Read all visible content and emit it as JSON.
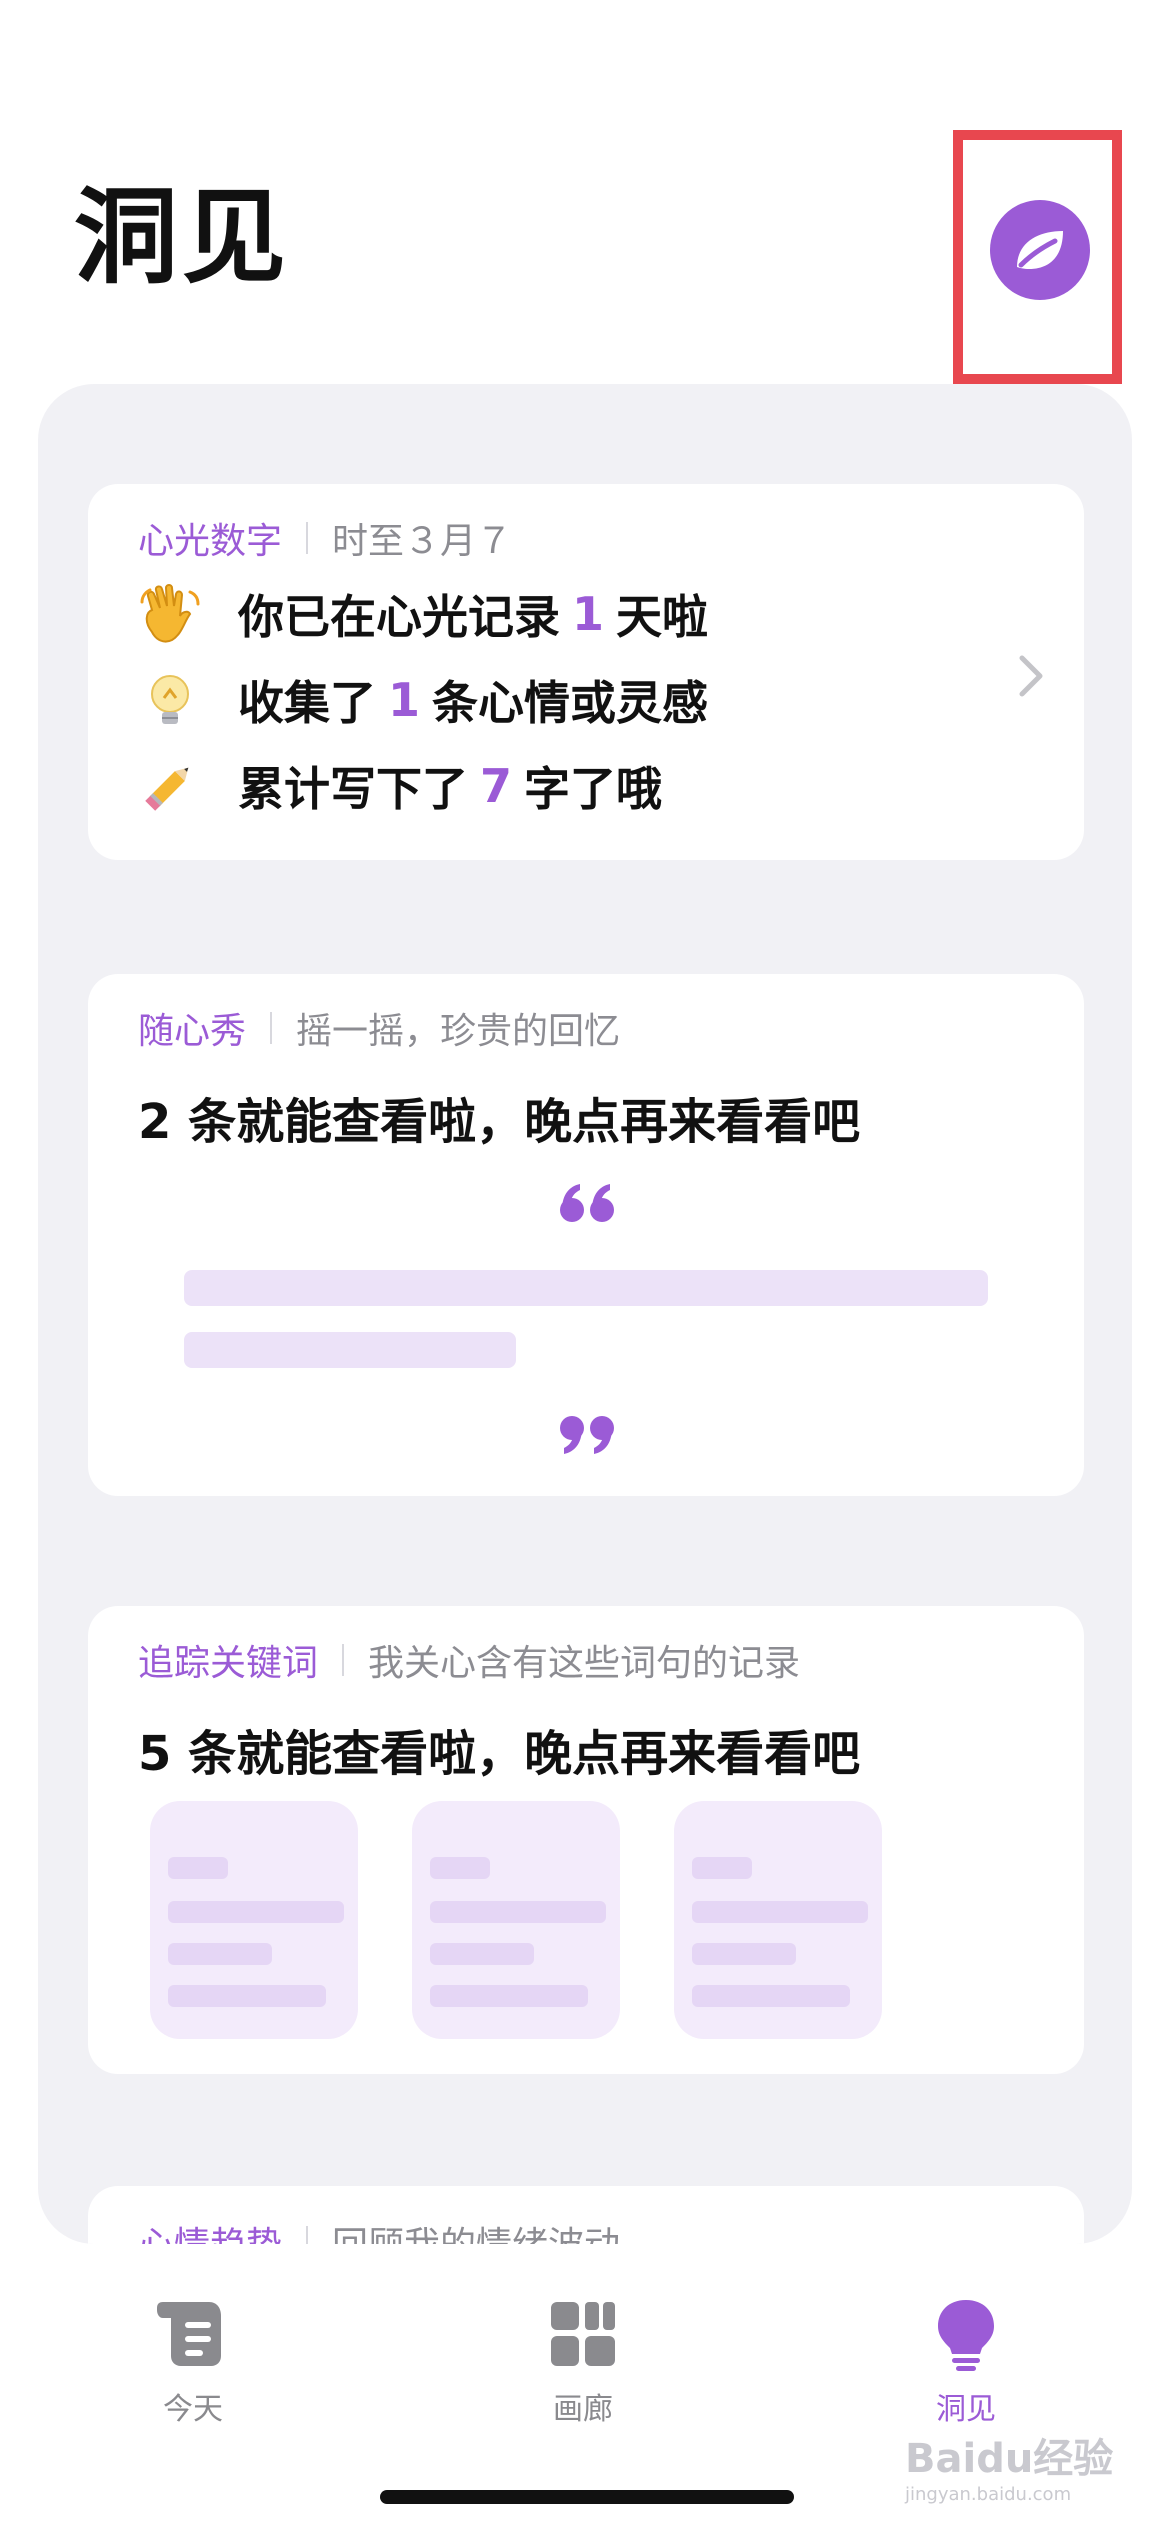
{
  "header": {
    "title": "洞见"
  },
  "stats_card": {
    "title": "心光数字",
    "subtitle": "时至３月７",
    "rows": [
      {
        "icon": "waving-hand-icon",
        "pre": "你已在心光记录",
        "num": "1",
        "post": "天啦"
      },
      {
        "icon": "light-bulb-icon",
        "pre": "收集了",
        "num": "1",
        "post": "条心情或灵感"
      },
      {
        "icon": "pencil-icon",
        "pre": "累计写下了",
        "num": "7",
        "post": "字了哦"
      }
    ]
  },
  "random_card": {
    "title": "随心秀",
    "subtitle": "摇一摇，珍贵的回忆",
    "message": "2 条就能查看啦，晚点再来看看吧"
  },
  "keywords_card": {
    "title": "追踪关键词",
    "subtitle": "我关心含有这些词句的记录",
    "message": "5 条就能查看啦，晚点再来看看吧"
  },
  "mood_card": {
    "title": "心情趋势",
    "subtitle": "回顾我的情绪波动"
  },
  "tabbar": {
    "tabs": [
      {
        "label": "今天",
        "icon": "scroll-icon",
        "active": false
      },
      {
        "label": "画廊",
        "icon": "grid-icon",
        "active": false
      },
      {
        "label": "洞见",
        "icon": "light-bulb-icon",
        "active": true
      }
    ]
  },
  "watermark": {
    "text": "Baidu经验",
    "sub": "jingyan.baidu.com"
  },
  "colors": {
    "accent": "#9b5bd6",
    "highlight": "#e8474f",
    "panel": "#f1f1f5"
  }
}
